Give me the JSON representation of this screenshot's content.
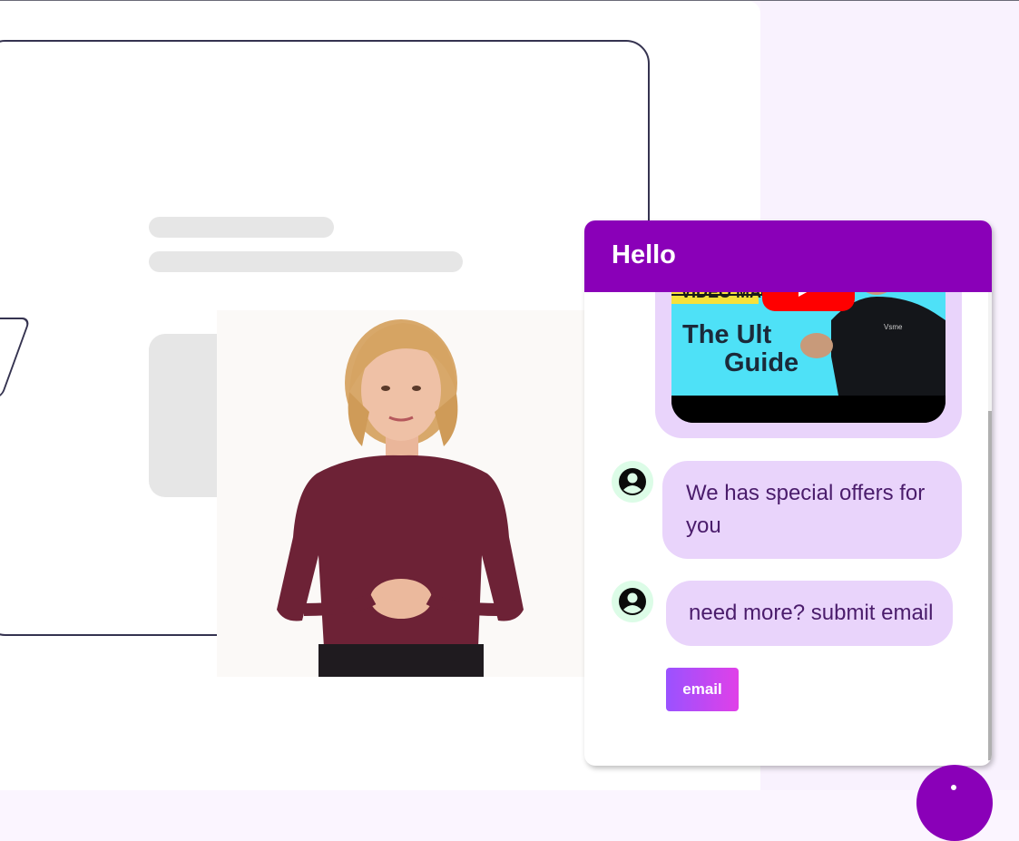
{
  "chat": {
    "title": "Hello",
    "video": {
      "title_fragment": "VIDEO MA",
      "text_line1": "The Ult",
      "text_line2": "Guide",
      "shirt_logo": "Vsme",
      "play_icon": "youtube-play-icon"
    },
    "messages": [
      {
        "sender": "bot",
        "text": "We has special offers for you"
      },
      {
        "sender": "bot",
        "text": "need more? submit email"
      }
    ],
    "email_button_label": "email"
  },
  "colors": {
    "header": "#8a00b8",
    "bubble": "#e9d4fb",
    "bubble_text": "#4a1c6b",
    "avatar_bg": "#dcfce7",
    "button_gradient_start": "#9a52ff",
    "button_gradient_end": "#e040e8",
    "page_background": "#fbf5ff",
    "skeleton": "#e6e6e6"
  },
  "icons": {
    "bot_avatar": "user-circle-icon",
    "launcher": "chat-launcher-icon"
  }
}
